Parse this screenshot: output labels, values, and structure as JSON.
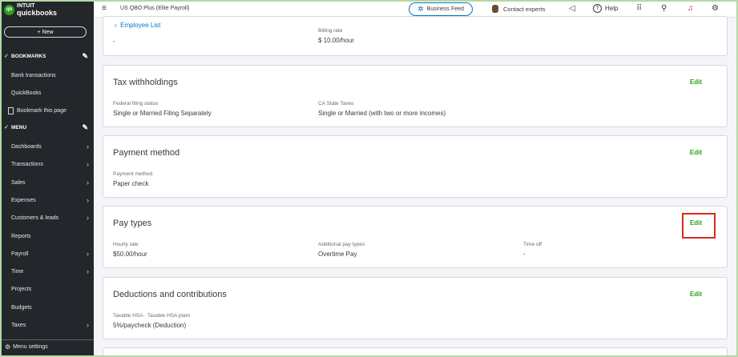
{
  "app": {
    "logo_intuit": "INTUIT",
    "logo_product": "quickbooks",
    "logo_badge": "qb",
    "company_name": "US QBO Plus (Elite Payroll)"
  },
  "sidebar": {
    "new_button": "+ New",
    "bookmarks_heading": "BOOKMARKS",
    "bookmarks": [
      {
        "label": "Bank transactions"
      },
      {
        "label": "QuickBooks"
      },
      {
        "label": "Bookmark this page"
      }
    ],
    "menu_heading": "MENU",
    "menu_items": [
      {
        "label": "Dashboards",
        "chevron": true
      },
      {
        "label": "Transactions",
        "chevron": true
      },
      {
        "label": "Sales",
        "chevron": true
      },
      {
        "label": "Expenses",
        "chevron": true
      },
      {
        "label": "Customers & leads",
        "chevron": true
      },
      {
        "label": "Reports",
        "chevron": false
      },
      {
        "label": "Payroll",
        "chevron": true
      },
      {
        "label": "Time",
        "chevron": true
      },
      {
        "label": "Projects",
        "chevron": false
      },
      {
        "label": "Budgets",
        "chevron": false
      },
      {
        "label": "Taxes",
        "chevron": true
      }
    ],
    "menu_settings": "Menu settings"
  },
  "topbar": {
    "business_feed": "Business Feed",
    "contact_experts": "Contact experts",
    "help": "Help"
  },
  "page": {
    "back_link": "Employee List",
    "top_card": {
      "left_value": "-",
      "billing_rate_label": "Billing rate",
      "billing_rate_value": "$ 10.00/hour"
    },
    "sections": [
      {
        "title": "Tax withholdings",
        "edit": "Edit",
        "fields": [
          {
            "label": "Federal filing status",
            "value": "Single or Married Filing Separately"
          },
          {
            "label": "CA State Taxes",
            "value": "Single or Married (with two or more incomes)"
          }
        ]
      },
      {
        "title": "Payment method",
        "edit": "Edit",
        "fields": [
          {
            "label": "Payment method",
            "value": "Paper check"
          }
        ]
      },
      {
        "title": "Pay types",
        "edit": "Edit",
        "fields": [
          {
            "label": "Hourly rate",
            "value": "$50.00/hour"
          },
          {
            "label": "Additional pay types",
            "value": "Overtime Pay"
          },
          {
            "label": "Time off",
            "value": "-"
          }
        ]
      },
      {
        "title": "Deductions and contributions",
        "edit": "Edit",
        "fields": [
          {
            "label": "Taxable HSA · Taxable HSA plam",
            "value": "5%/paycheck (Deduction)"
          }
        ]
      }
    ]
  },
  "colors": {
    "sidebar_bg": "#23262b",
    "accent_green": "#2ca01c",
    "link_blue": "#0077c5",
    "highlight_red": "#d52b1e"
  }
}
